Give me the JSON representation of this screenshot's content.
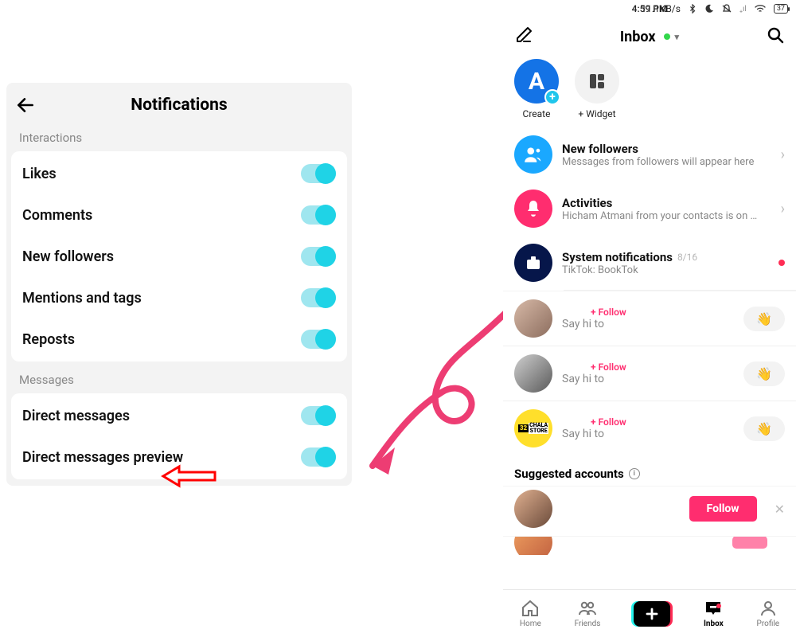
{
  "left": {
    "title": "Notifications",
    "sections": {
      "interactions": {
        "header": "Interactions",
        "items": [
          "Likes",
          "Comments",
          "New followers",
          "Mentions and tags",
          "Reposts"
        ]
      },
      "messages": {
        "header": "Messages",
        "items": [
          "Direct messages",
          "Direct messages preview"
        ]
      }
    }
  },
  "right": {
    "status": {
      "time": "4:59 PM",
      "net": "11.1KB/s",
      "battery": "37"
    },
    "header": {
      "title": "Inbox"
    },
    "top": {
      "create": "Create",
      "widget": "+ Widget"
    },
    "rows": {
      "followers": {
        "title": "New followers",
        "sub": "Messages from followers will appear here"
      },
      "activities": {
        "title": "Activities",
        "sub": "Hicham Atmani from your contacts is on …"
      },
      "system": {
        "title": "System notifications",
        "date": "8/16",
        "sub": "TikTok: BookTok"
      }
    },
    "say_hi": "Say hi to",
    "follow_tag": "+ Follow",
    "wave": "👋",
    "chala": "CHALA\nSTORE",
    "suggested": "Suggested accounts",
    "follow_btn": "Follow",
    "tabs": {
      "home": "Home",
      "friends": "Friends",
      "inbox": "Inbox",
      "profile": "Profile"
    }
  }
}
